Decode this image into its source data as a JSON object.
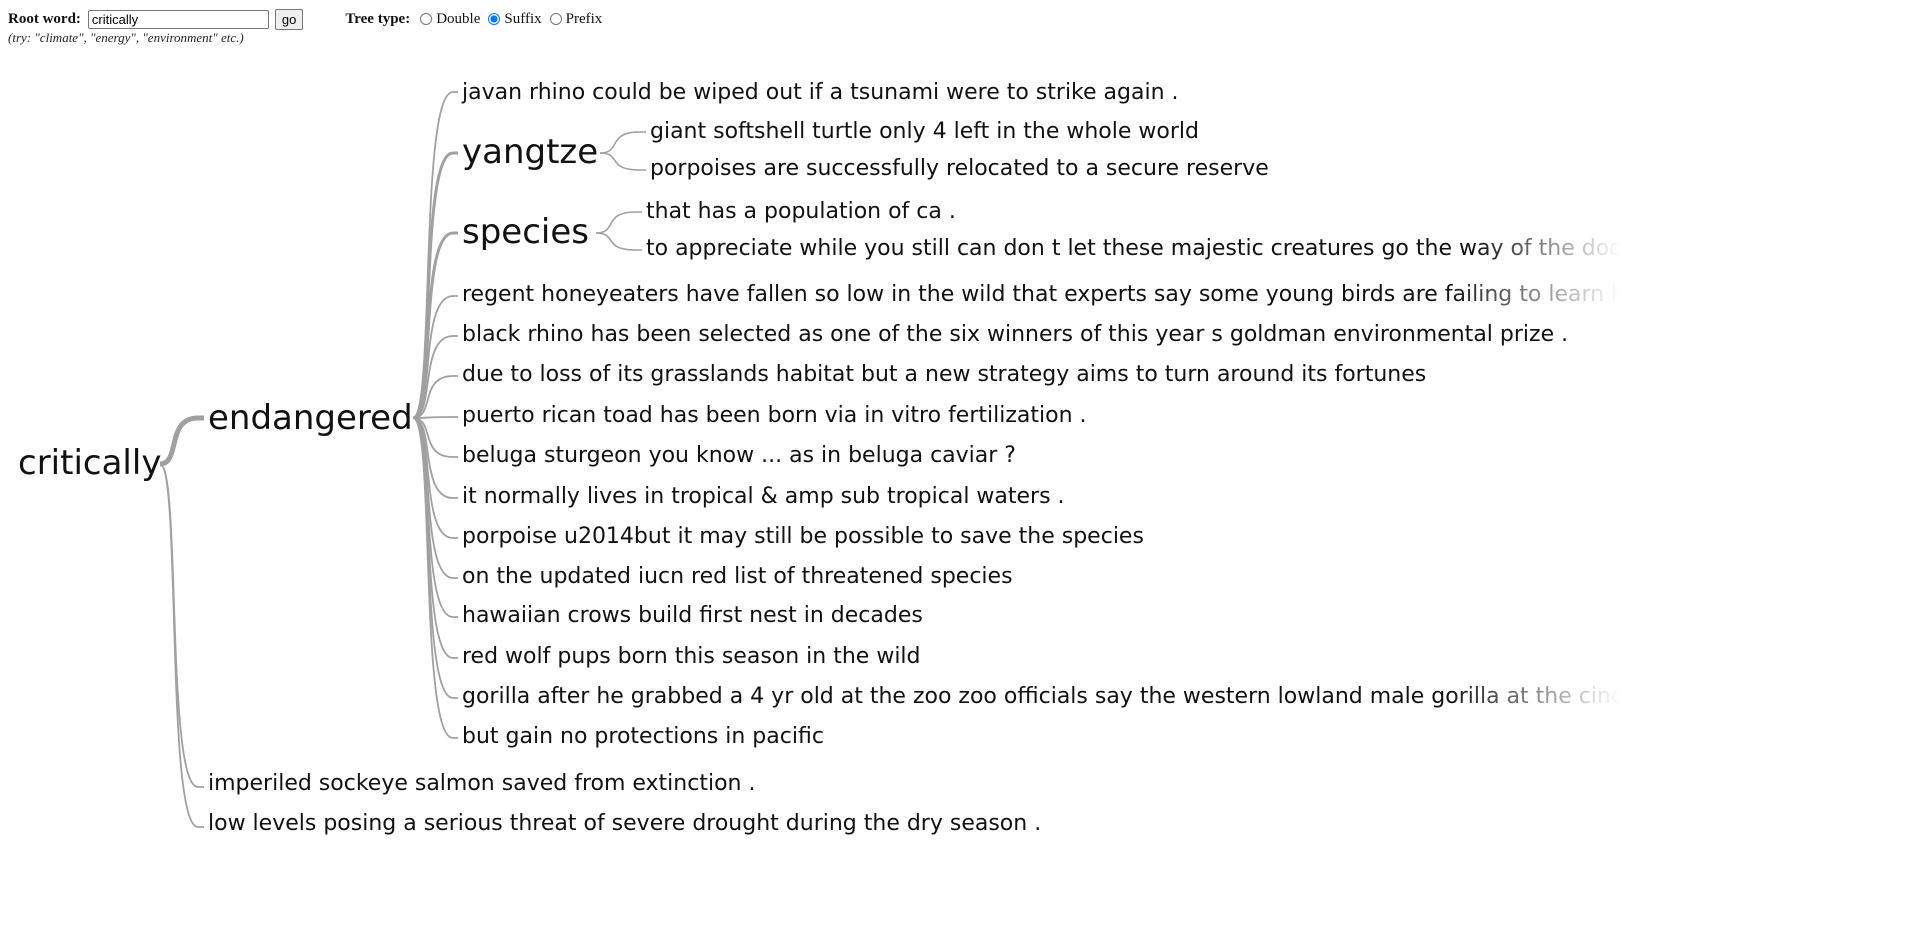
{
  "controls": {
    "root_label": "Root word:",
    "root_value": "critically",
    "go_label": "go",
    "tree_type_label": "Tree type:",
    "options": [
      "Double",
      "Suffix",
      "Prefix"
    ],
    "selected": "Suffix",
    "hint": "(try: \"climate\", \"energy\", \"environment\" etc.)"
  },
  "tree": {
    "root": "critically",
    "branch_endangered": "endangered",
    "branch_yangtze": "yangtze",
    "branch_species": "species",
    "leaves_top": [
      "javan rhino could be wiped out if a tsunami were to strike again ."
    ],
    "yangtze_leaves": [
      "giant softshell turtle only 4 left in the whole world",
      "porpoises are successfully relocated to a secure reserve"
    ],
    "species_leaves": [
      "that has a population of ca .",
      "to appreciate while you still can don t let these majestic creatures go the way of the dodo"
    ],
    "endangered_leaves": [
      "regent honeyeaters have fallen so low in the wild that experts say some young birds are failing to learn how",
      "black rhino has been selected as one of the six winners of this year s goldman environmental prize .",
      "due to loss of its grasslands habitat but a new strategy aims to turn around its fortunes",
      "puerto rican toad has been born via in vitro fertilization .",
      "beluga sturgeon you know ... as in beluga caviar ?",
      "it normally lives in tropical & amp sub tropical waters .",
      "porpoise u2014but it may still be possible to save the species",
      "on the updated iucn red list of threatened species",
      "hawaiian crows build first nest in decades",
      "red wolf pups born this season in the wild",
      "gorilla after he grabbed a 4 yr old at the zoo zoo officials say the western lowland male gorilla at the cincinnati",
      "but gain no protections in pacific"
    ],
    "root_leaves": [
      "imperiled sockeye salmon saved from extinction .",
      "low levels posing a serious threat of severe drought during the dry season ."
    ]
  }
}
